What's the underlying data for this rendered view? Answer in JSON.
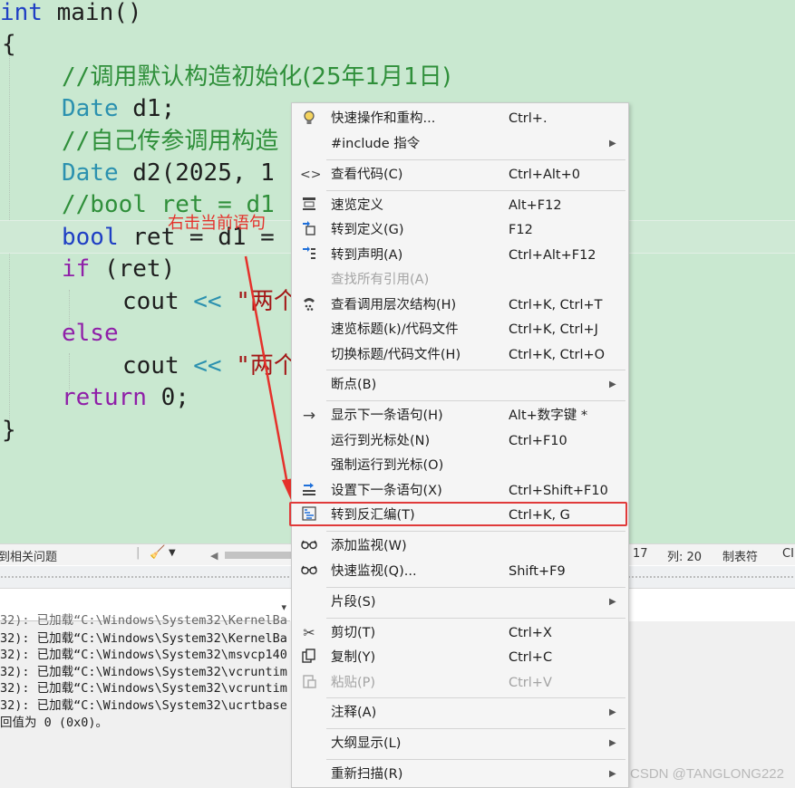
{
  "editor": {
    "lines": {
      "l1": {
        "kw": "int",
        "rest": " main()"
      },
      "l2": {
        "text": "{"
      },
      "l3": {
        "slashes": "//",
        "text": "调用默认构造初始化(25年1月1日)"
      },
      "l4": {
        "type": "Date",
        "rest": " d1;"
      },
      "l5": {
        "slashes": "//",
        "text": "自己传参调用构造"
      },
      "l6": {
        "type": "Date",
        "rest": " d2(2025, 1"
      },
      "l7": {
        "text": "//bool ret = d1"
      },
      "l8": {
        "kw": "bool",
        "rest": " ret = d1 ="
      },
      "l9": {
        "kw": "if",
        "rest": " (ret)"
      },
      "l10": {
        "ident": "cout",
        "op": " << ",
        "str": "\"两个"
      },
      "l11": {
        "kw": "else"
      },
      "l12": {
        "ident": "cout",
        "op": " << ",
        "str": "\"两个"
      },
      "l13": {
        "kw": "return",
        "rest": " 0;"
      },
      "l14": {
        "text": "}"
      }
    },
    "annotation": "右击当前语句"
  },
  "statusbar": {
    "issues": "到相关问题",
    "line_suffix": "17",
    "column": "列: 20",
    "tab_mode": "制表符",
    "trailing": "CI"
  },
  "output": {
    "rows": [
      "32): 已加载“C:\\Windows\\System32\\KernelBa",
      "32): 已加载“C:\\Windows\\System32\\msvcp140",
      "32): 已加载“C:\\Windows\\System32\\vcruntim",
      "32): 已加载“C:\\Windows\\System32\\vcruntim",
      "32): 已加载“C:\\Windows\\System32\\ucrtbase",
      "回值为 0 (0x0)。"
    ]
  },
  "watermark": "CSDN @TANGLONG222",
  "context_menu": {
    "items": [
      {
        "label": "快速操作和重构...",
        "shortcut": "Ctrl+.",
        "icon": "lightbulb-icon",
        "submenu": false,
        "disabled": false
      },
      {
        "label": "#include 指令",
        "shortcut": "",
        "icon": "",
        "submenu": true,
        "disabled": false
      },
      {
        "label": "查看代码(C)",
        "shortcut": "Ctrl+Alt+0",
        "icon": "code-icon",
        "submenu": false,
        "disabled": false
      },
      {
        "label": "速览定义",
        "shortcut": "Alt+F12",
        "icon": "peek-definition-icon",
        "submenu": false,
        "disabled": false
      },
      {
        "label": "转到定义(G)",
        "shortcut": "F12",
        "icon": "goto-definition-icon",
        "submenu": false,
        "disabled": false
      },
      {
        "label": "转到声明(A)",
        "shortcut": "Ctrl+Alt+F12",
        "icon": "goto-declaration-icon",
        "submenu": false,
        "disabled": false
      },
      {
        "label": "查找所有引用(A)",
        "shortcut": "",
        "icon": "",
        "submenu": false,
        "disabled": true
      },
      {
        "label": "查看调用层次结构(H)",
        "shortcut": "Ctrl+K, Ctrl+T",
        "icon": "call-hierarchy-icon",
        "submenu": false,
        "disabled": false
      },
      {
        "label": "速览标题(k)/代码文件",
        "shortcut": "Ctrl+K, Ctrl+J",
        "icon": "",
        "submenu": false,
        "disabled": false
      },
      {
        "label": "切换标题/代码文件(H)",
        "shortcut": "Ctrl+K, Ctrl+O",
        "icon": "",
        "submenu": false,
        "disabled": false
      },
      {
        "label": "断点(B)",
        "shortcut": "",
        "icon": "",
        "submenu": true,
        "disabled": false
      },
      {
        "label": "显示下一条语句(H)",
        "shortcut": "Alt+数字键 *",
        "icon": "arrow-right-icon",
        "submenu": false,
        "disabled": false
      },
      {
        "label": "运行到光标处(N)",
        "shortcut": "Ctrl+F10",
        "icon": "",
        "submenu": false,
        "disabled": false
      },
      {
        "label": "强制运行到光标(O)",
        "shortcut": "",
        "icon": "",
        "submenu": false,
        "disabled": false
      },
      {
        "label": "设置下一条语句(X)",
        "shortcut": "Ctrl+Shift+F10",
        "icon": "set-next-statement-icon",
        "submenu": false,
        "disabled": false
      },
      {
        "label": "转到反汇编(T)",
        "shortcut": "Ctrl+K, G",
        "icon": "disassembly-icon",
        "submenu": false,
        "disabled": false
      },
      {
        "label": "添加监视(W)",
        "shortcut": "",
        "icon": "glasses-icon",
        "submenu": false,
        "disabled": false
      },
      {
        "label": "快速监视(Q)...",
        "shortcut": "Shift+F9",
        "icon": "glasses-icon",
        "submenu": false,
        "disabled": false
      },
      {
        "label": "片段(S)",
        "shortcut": "",
        "icon": "",
        "submenu": true,
        "disabled": false
      },
      {
        "label": "剪切(T)",
        "shortcut": "Ctrl+X",
        "icon": "scissors-icon",
        "submenu": false,
        "disabled": false
      },
      {
        "label": "复制(Y)",
        "shortcut": "Ctrl+C",
        "icon": "copy-icon",
        "submenu": false,
        "disabled": false
      },
      {
        "label": "粘贴(P)",
        "shortcut": "Ctrl+V",
        "icon": "paste-icon",
        "submenu": false,
        "disabled": true
      },
      {
        "label": "注释(A)",
        "shortcut": "",
        "icon": "",
        "submenu": true,
        "disabled": false
      },
      {
        "label": "大纲显示(L)",
        "shortcut": "",
        "icon": "",
        "submenu": true,
        "disabled": false
      },
      {
        "label": "重新扫描(R)",
        "shortcut": "",
        "icon": "",
        "submenu": true,
        "disabled": false
      }
    ]
  },
  "colors": {
    "editor_bg": "#c9e8d0",
    "comment": "#2f8f3a",
    "keyword": "#1f3fc4",
    "type": "#2b91af",
    "control": "#8f1fa8",
    "highlight_box": "#e03a3a",
    "annotation": "#e5312b"
  }
}
